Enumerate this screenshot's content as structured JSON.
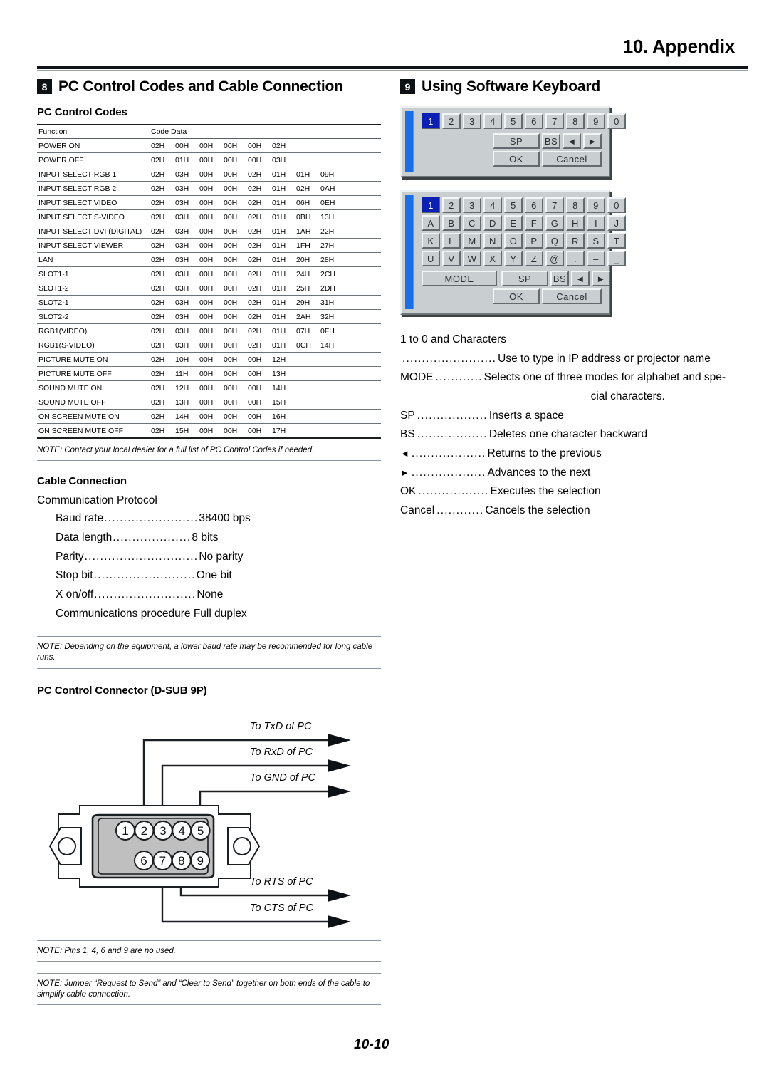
{
  "header": {
    "title": "10. Appendix"
  },
  "footer": {
    "page_number": "10-10"
  },
  "section_pc": {
    "badge": "8",
    "title": "PC Control Codes and Cable Connection",
    "subhead_codes": "PC Control Codes",
    "table": {
      "columns": [
        "Function",
        "Code Data"
      ],
      "rows": [
        {
          "function": "POWER ON",
          "codes": [
            "02H",
            "00H",
            "00H",
            "00H",
            "00H",
            "02H"
          ]
        },
        {
          "function": "POWER OFF",
          "codes": [
            "02H",
            "01H",
            "00H",
            "00H",
            "00H",
            "03H"
          ]
        },
        {
          "function": "INPUT SELECT RGB 1",
          "codes": [
            "02H",
            "03H",
            "00H",
            "00H",
            "02H",
            "01H",
            "01H",
            "09H"
          ]
        },
        {
          "function": "INPUT SELECT RGB 2",
          "codes": [
            "02H",
            "03H",
            "00H",
            "00H",
            "02H",
            "01H",
            "02H",
            "0AH"
          ]
        },
        {
          "function": "INPUT SELECT VIDEO",
          "codes": [
            "02H",
            "03H",
            "00H",
            "00H",
            "02H",
            "01H",
            "06H",
            "0EH"
          ]
        },
        {
          "function": "INPUT SELECT S-VIDEO",
          "codes": [
            "02H",
            "03H",
            "00H",
            "00H",
            "02H",
            "01H",
            "0BH",
            "13H"
          ]
        },
        {
          "function": "INPUT SELECT DVI (DIGITAL)",
          "codes": [
            "02H",
            "03H",
            "00H",
            "00H",
            "02H",
            "01H",
            "1AH",
            "22H"
          ]
        },
        {
          "function": "INPUT SELECT VIEWER",
          "codes": [
            "02H",
            "03H",
            "00H",
            "00H",
            "02H",
            "01H",
            "1FH",
            "27H"
          ]
        },
        {
          "function": "LAN",
          "codes": [
            "02H",
            "03H",
            "00H",
            "00H",
            "02H",
            "01H",
            "20H",
            "28H"
          ]
        },
        {
          "function": "SLOT1-1",
          "codes": [
            "02H",
            "03H",
            "00H",
            "00H",
            "02H",
            "01H",
            "24H",
            "2CH"
          ]
        },
        {
          "function": "SLOT1-2",
          "codes": [
            "02H",
            "03H",
            "00H",
            "00H",
            "02H",
            "01H",
            "25H",
            "2DH"
          ]
        },
        {
          "function": "SLOT2-1",
          "codes": [
            "02H",
            "03H",
            "00H",
            "00H",
            "02H",
            "01H",
            "29H",
            "31H"
          ]
        },
        {
          "function": "SLOT2-2",
          "codes": [
            "02H",
            "03H",
            "00H",
            "00H",
            "02H",
            "01H",
            "2AH",
            "32H"
          ]
        },
        {
          "function": "RGB1(VIDEO)",
          "codes": [
            "02H",
            "03H",
            "00H",
            "00H",
            "02H",
            "01H",
            "07H",
            "0FH"
          ]
        },
        {
          "function": "RGB1(S-VIDEO)",
          "codes": [
            "02H",
            "03H",
            "00H",
            "00H",
            "02H",
            "01H",
            "0CH",
            "14H"
          ]
        },
        {
          "function": "PICTURE MUTE ON",
          "codes": [
            "02H",
            "10H",
            "00H",
            "00H",
            "00H",
            "12H"
          ]
        },
        {
          "function": "PICTURE MUTE OFF",
          "codes": [
            "02H",
            "11H",
            "00H",
            "00H",
            "00H",
            "13H"
          ]
        },
        {
          "function": "SOUND MUTE ON",
          "codes": [
            "02H",
            "12H",
            "00H",
            "00H",
            "00H",
            "14H"
          ]
        },
        {
          "function": "SOUND MUTE OFF",
          "codes": [
            "02H",
            "13H",
            "00H",
            "00H",
            "00H",
            "15H"
          ]
        },
        {
          "function": "ON SCREEN MUTE ON",
          "codes": [
            "02H",
            "14H",
            "00H",
            "00H",
            "00H",
            "16H"
          ]
        },
        {
          "function": "ON SCREEN MUTE OFF",
          "codes": [
            "02H",
            "15H",
            "00H",
            "00H",
            "00H",
            "17H"
          ]
        }
      ]
    },
    "note_codes": "NOTE: Contact your local dealer for a full list of PC Control Codes if needed.",
    "subhead_cable": "Cable Connection",
    "protocol_title": "Communication Protocol",
    "protocol": [
      {
        "term": "Baud rate",
        "dots": "........................",
        "value": "38400 bps"
      },
      {
        "term": "Data length",
        "dots": "....................",
        "value": "8 bits"
      },
      {
        "term": "Parity",
        "dots": ".............................",
        "value": "No parity"
      },
      {
        "term": "Stop bit",
        "dots": "..........................",
        "value": "One bit"
      },
      {
        "term": "X on/off",
        "dots": "..........................",
        "value": "None"
      }
    ],
    "protocol_last": "Communications procedure Full duplex",
    "note_baud": "NOTE: Depending on the equipment, a lower baud rate may be recommended for long cable runs.",
    "subhead_connector": "PC Control Connector (D-SUB 9P)",
    "connector": {
      "pins_top": [
        "1",
        "2",
        "3",
        "4",
        "5"
      ],
      "pins_bottom": [
        "6",
        "7",
        "8",
        "9"
      ],
      "wires": [
        {
          "label": "To TxD of PC"
        },
        {
          "label": "To RxD of PC"
        },
        {
          "label": "To GND of PC"
        },
        {
          "label": "To RTS of PC"
        },
        {
          "label": "To CTS of PC"
        }
      ]
    },
    "note_pins": "NOTE: Pins 1, 4, 6 and 9 are no used.",
    "note_jumper": "NOTE: Jumper “Request to Send” and “Clear to Send” together on both ends of the cable to simplify cable connection."
  },
  "section_keyboard": {
    "badge": "9",
    "title": "Using Software Keyboard",
    "keyboard_numeric": {
      "selected_key": "1",
      "rows": [
        [
          "1",
          "2",
          "3",
          "4",
          "5",
          "6",
          "7",
          "8",
          "9",
          "0"
        ]
      ],
      "controls_row": [
        "SP",
        "BS",
        "◄",
        "►"
      ],
      "confirm_row": [
        "OK",
        "Cancel"
      ]
    },
    "keyboard_alpha": {
      "selected_key": "1",
      "rows": [
        [
          "1",
          "2",
          "3",
          "4",
          "5",
          "6",
          "7",
          "8",
          "9",
          "0"
        ],
        [
          "A",
          "B",
          "C",
          "D",
          "E",
          "F",
          "G",
          "H",
          "I",
          "J"
        ],
        [
          "K",
          "L",
          "M",
          "N",
          "O",
          "P",
          "Q",
          "R",
          "S",
          "T"
        ],
        [
          "U",
          "V",
          "W",
          "X",
          "Y",
          "Z",
          "@",
          ".",
          "–",
          "_"
        ]
      ],
      "mode_key": "MODE",
      "controls_row": [
        "SP",
        "BS",
        "◄",
        "►"
      ],
      "confirm_row": [
        "OK",
        "Cancel"
      ]
    },
    "legend_lead": "1 to 0 and Characters",
    "legend": [
      {
        "term": "",
        "dots": "........................",
        "value": "Use to type in IP address or projector name",
        "cont": ""
      },
      {
        "term": "MODE",
        "dots": "............",
        "value": "Selects one of three modes for alphabet and spe-",
        "cont": "cial characters."
      },
      {
        "term": "SP",
        "dots": "..................",
        "value": "Inserts a space",
        "cont": ""
      },
      {
        "term": "BS",
        "dots": "..................",
        "value": "Deletes one character backward",
        "cont": ""
      },
      {
        "term": "◄",
        "dots": "...................",
        "value": "Returns to the previous",
        "cont": ""
      },
      {
        "term": "►",
        "dots": "...................",
        "value": "Advances to the next",
        "cont": ""
      },
      {
        "term": "OK",
        "dots": "..................",
        "value": "Executes the selection",
        "cont": ""
      },
      {
        "term": "Cancel",
        "dots": "............",
        "value": "Cancels the selection",
        "cont": ""
      }
    ]
  }
}
